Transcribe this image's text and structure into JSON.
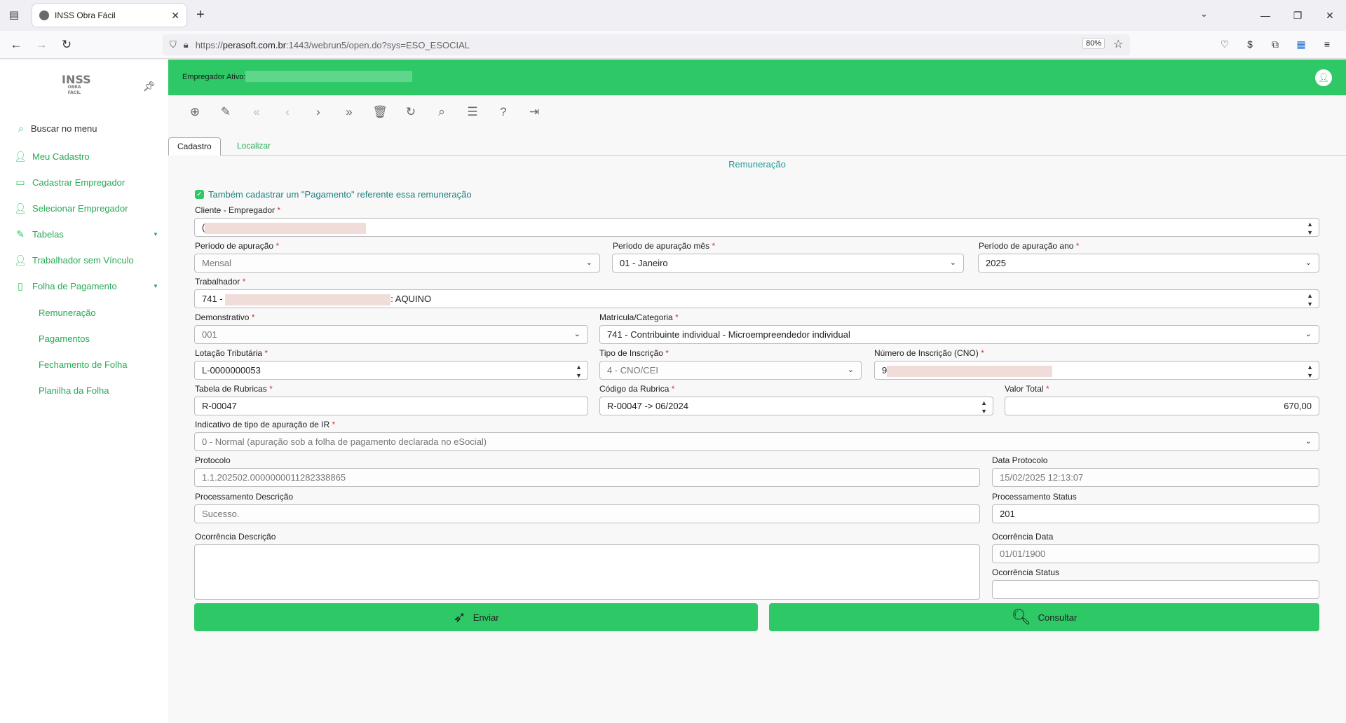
{
  "browser": {
    "tab_title": "INSS Obra Fácil",
    "url_prefix": "https://",
    "url_host": "perasoft.com.br",
    "url_rest": ":1443/webrun5/open.do?sys=ESO_ESOCIAL",
    "zoom": "80%"
  },
  "sidebar": {
    "logo_main": "INSS",
    "logo_sub": "OBRA FÁCIL",
    "search_label": "Buscar no menu",
    "items": [
      {
        "label": "Meu Cadastro",
        "icon": "user-edit-icon"
      },
      {
        "label": "Cadastrar Empregador",
        "icon": "id-card-icon"
      },
      {
        "label": "Selecionar Empregador",
        "icon": "user-check-icon"
      },
      {
        "label": "Tabelas",
        "icon": "edit-file-icon"
      },
      {
        "label": "Trabalhador sem Vínculo",
        "icon": "user-cog-icon"
      },
      {
        "label": "Folha de Pagamento",
        "icon": "file-dollar-icon"
      }
    ],
    "subitems": [
      "Remuneração",
      "Pagamentos",
      "Fechamento de Folha",
      "Planilha da Folha"
    ]
  },
  "topbar": {
    "employer_label": "Empregador Ativo:"
  },
  "tabs": {
    "cadastro": "Cadastro",
    "localizar": "Localizar"
  },
  "form": {
    "section_title": "Remuneração",
    "checkbox_label": "Também cadastrar um \"Pagamento\" referente essa remuneração",
    "cliente_label": "Cliente - Empregador",
    "cliente_value": "(",
    "periodo_label": "Período de apuração",
    "periodo_value": "Mensal",
    "periodo_mes_label": "Período de apuração mês",
    "periodo_mes_value": "01 - Janeiro",
    "periodo_ano_label": "Período de apuração ano",
    "periodo_ano_value": "2025",
    "trabalhador_label": "Trabalhador",
    "trabalhador_prefix": "741 -",
    "trabalhador_suffix": ": AQUINO",
    "demonstrativo_label": "Demonstrativo",
    "demonstrativo_value": "001",
    "matricula_label": "Matrícula/Categoria",
    "matricula_value": "741 - Contribuinte individual - Microempreendedor individual",
    "lotacao_label": "Lotação Tributária",
    "lotacao_value": "L-0000000053",
    "tipo_inscricao_label": "Tipo de Inscrição",
    "tipo_inscricao_value": "4 - CNO/CEI",
    "numero_inscricao_label": "Número de Inscrição (CNO)",
    "numero_inscricao_value": "9",
    "tabela_rubricas_label": "Tabela de Rubricas",
    "tabela_rubricas_value": "R-00047",
    "codigo_rubrica_label": "Código da Rubrica",
    "codigo_rubrica_value": "R-00047 -> 06/2024",
    "valor_total_label": "Valor Total",
    "valor_total_value": "670,00",
    "indicativo_label": "Indicativo de tipo de apuração de IR",
    "indicativo_value": "0 - Normal (apuração sob a folha de pagamento declarada no eSocial)",
    "protocolo_label": "Protocolo",
    "protocolo_value": "1.1.202502.0000000011282338865",
    "data_protocolo_label": "Data Protocolo",
    "data_protocolo_value": "15/02/2025 12:13:07",
    "proc_desc_label": "Processamento Descrição",
    "proc_desc_value": "Sucesso.",
    "proc_status_label": "Processamento Status",
    "proc_status_value": "201",
    "ocorr_desc_label": "Ocorrência Descrição",
    "ocorr_data_label": "Ocorrência Data",
    "ocorr_data_value": "01/01/1900",
    "ocorr_status_label": "Ocorrência Status",
    "ocorr_status_value": "",
    "required_mark": "*"
  },
  "buttons": {
    "enviar": "Enviar",
    "consultar": "Consultar"
  },
  "colors": {
    "accent": "#2ec866",
    "link": "#28a956",
    "title": "#1e9b9b"
  }
}
